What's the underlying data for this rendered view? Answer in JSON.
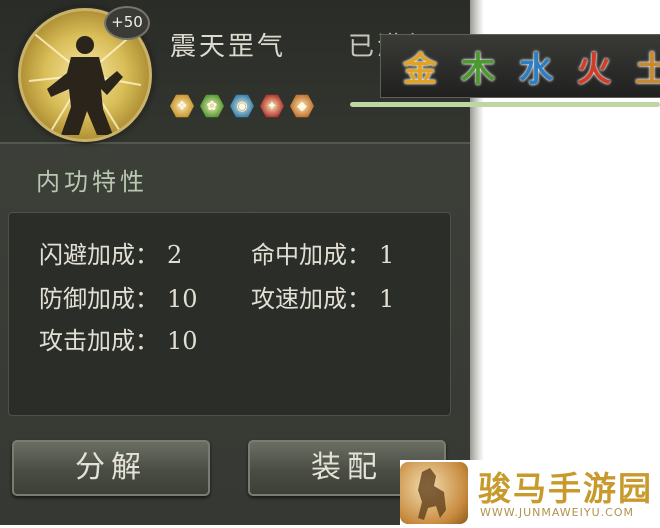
{
  "skill": {
    "bonus_badge": "+50",
    "name": "震天罡气",
    "level": "已满级"
  },
  "element_icons": [
    {
      "name": "metal-element-icon",
      "color": "#c9962a",
      "glyph": "❖"
    },
    {
      "name": "wood-element-icon",
      "color": "#4f9a2e",
      "glyph": "✿"
    },
    {
      "name": "water-element-icon",
      "color": "#2f7fb8",
      "glyph": "◉"
    },
    {
      "name": "fire-element-icon",
      "color": "#b3302a",
      "glyph": "✦"
    },
    {
      "name": "earth-element-icon",
      "color": "#c2702a",
      "glyph": "◆"
    }
  ],
  "elements_banner": [
    {
      "char": "金",
      "color": "#e2a322"
    },
    {
      "char": "木",
      "color": "#4c9a2f"
    },
    {
      "char": "水",
      "color": "#2d7ec3"
    },
    {
      "char": "火",
      "color": "#d43b26"
    },
    {
      "char": "土",
      "color": "#c8892f"
    }
  ],
  "section_title": "内功特性",
  "stats": {
    "dodge": {
      "label": "闪避加成：",
      "value": "2"
    },
    "hit": {
      "label": "命中加成：",
      "value": "1"
    },
    "defense": {
      "label": "防御加成：",
      "value": "10"
    },
    "attack_speed": {
      "label": "攻速加成：",
      "value": "1"
    },
    "attack": {
      "label": "攻击加成：",
      "value": "10"
    }
  },
  "buttons": {
    "decompose": "分解",
    "equip": "装配"
  },
  "watermark": {
    "name": "骏马手游园",
    "url": "WWW.JUNMAWEIYU.COM"
  }
}
